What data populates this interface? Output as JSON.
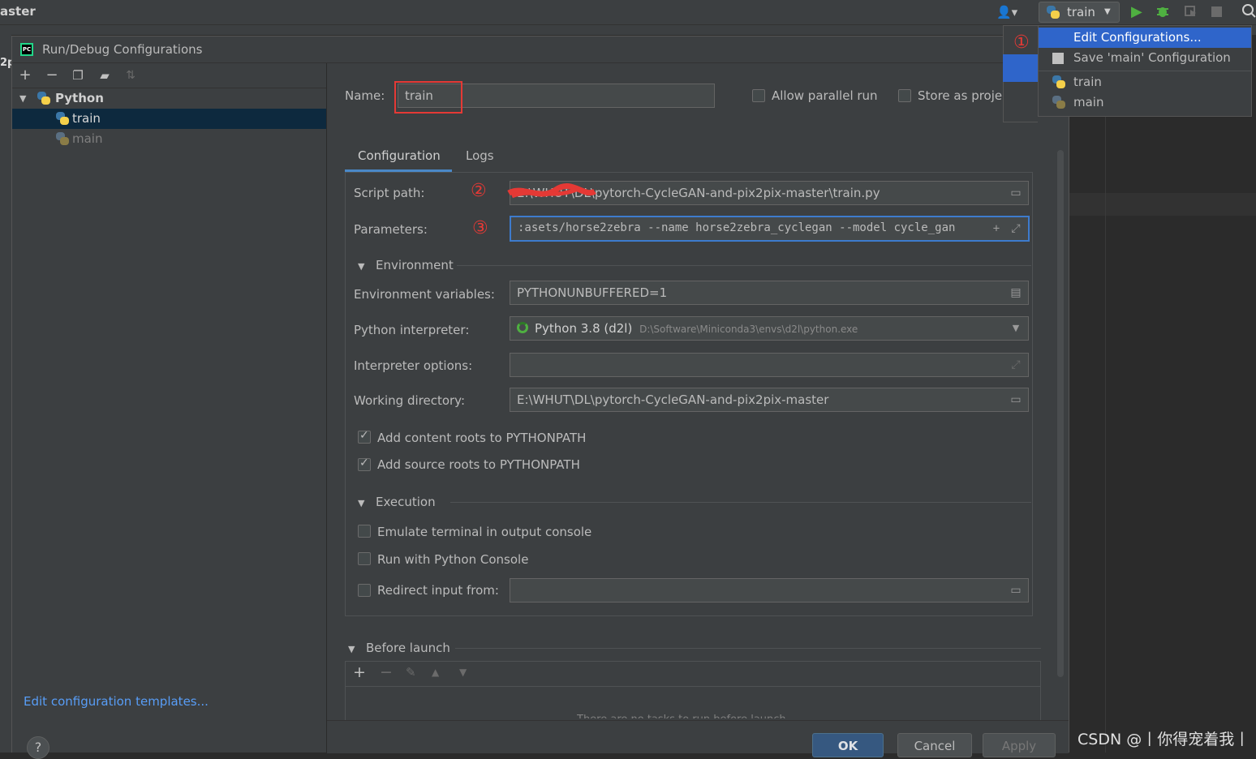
{
  "ide": {
    "branch_text": "aster",
    "side_text": "2p",
    "run_config": "train",
    "watermark": "CSDN @丨你得宠着我丨"
  },
  "dialog": {
    "title": "Run/Debug Configurations",
    "tree": {
      "group": "Python",
      "items": [
        "train",
        "main"
      ]
    },
    "edit_templates_link": "Edit configuration templates...",
    "help": "?"
  },
  "form": {
    "name_label": "Name:",
    "name_value": "train",
    "allow_parallel": "Allow parallel run",
    "store_as_project": "Store as projec",
    "tabs": [
      "Configuration",
      "Logs"
    ],
    "script_path_label": "Script path:",
    "script_path_value": "E:\\WHUT\\DL\\pytorch-CycleGAN-and-pix2pix-master\\train.py",
    "parameters_label": "Parameters:",
    "parameters_value": ":asets/horse2zebra --name horse2zebra_cyclegan --model cycle_gan",
    "environment_section": "Environment",
    "env_vars_label": "Environment variables:",
    "env_vars_value": "PYTHONUNBUFFERED=1",
    "interpreter_label": "Python interpreter:",
    "interpreter_name": "Python 3.8 (d2l)",
    "interpreter_path": "D:\\Software\\Miniconda3\\envs\\d2l\\python.exe",
    "interp_options_label": "Interpreter options:",
    "interp_options_value": "",
    "working_dir_label": "Working directory:",
    "working_dir_value": "E:\\WHUT\\DL\\pytorch-CycleGAN-and-pix2pix-master",
    "add_content_roots": "Add content roots to PYTHONPATH",
    "add_source_roots": "Add source roots to PYTHONPATH",
    "execution_section": "Execution",
    "emulate_terminal": "Emulate terminal in output console",
    "run_python_console": "Run with Python Console",
    "redirect_input": "Redirect input from:",
    "before_launch_section": "Before launch",
    "before_launch_empty": "There are no tasks to run before launch"
  },
  "buttons": {
    "ok": "OK",
    "cancel": "Cancel",
    "apply": "Apply"
  },
  "popup": {
    "items": [
      "Edit Configurations...",
      "Save 'main' Configuration",
      "train",
      "main"
    ]
  },
  "annotations": [
    "①",
    "②",
    "③"
  ],
  "colors": {
    "accent": "#2f65ca",
    "annotation": "#e53935",
    "link": "#589df6"
  }
}
